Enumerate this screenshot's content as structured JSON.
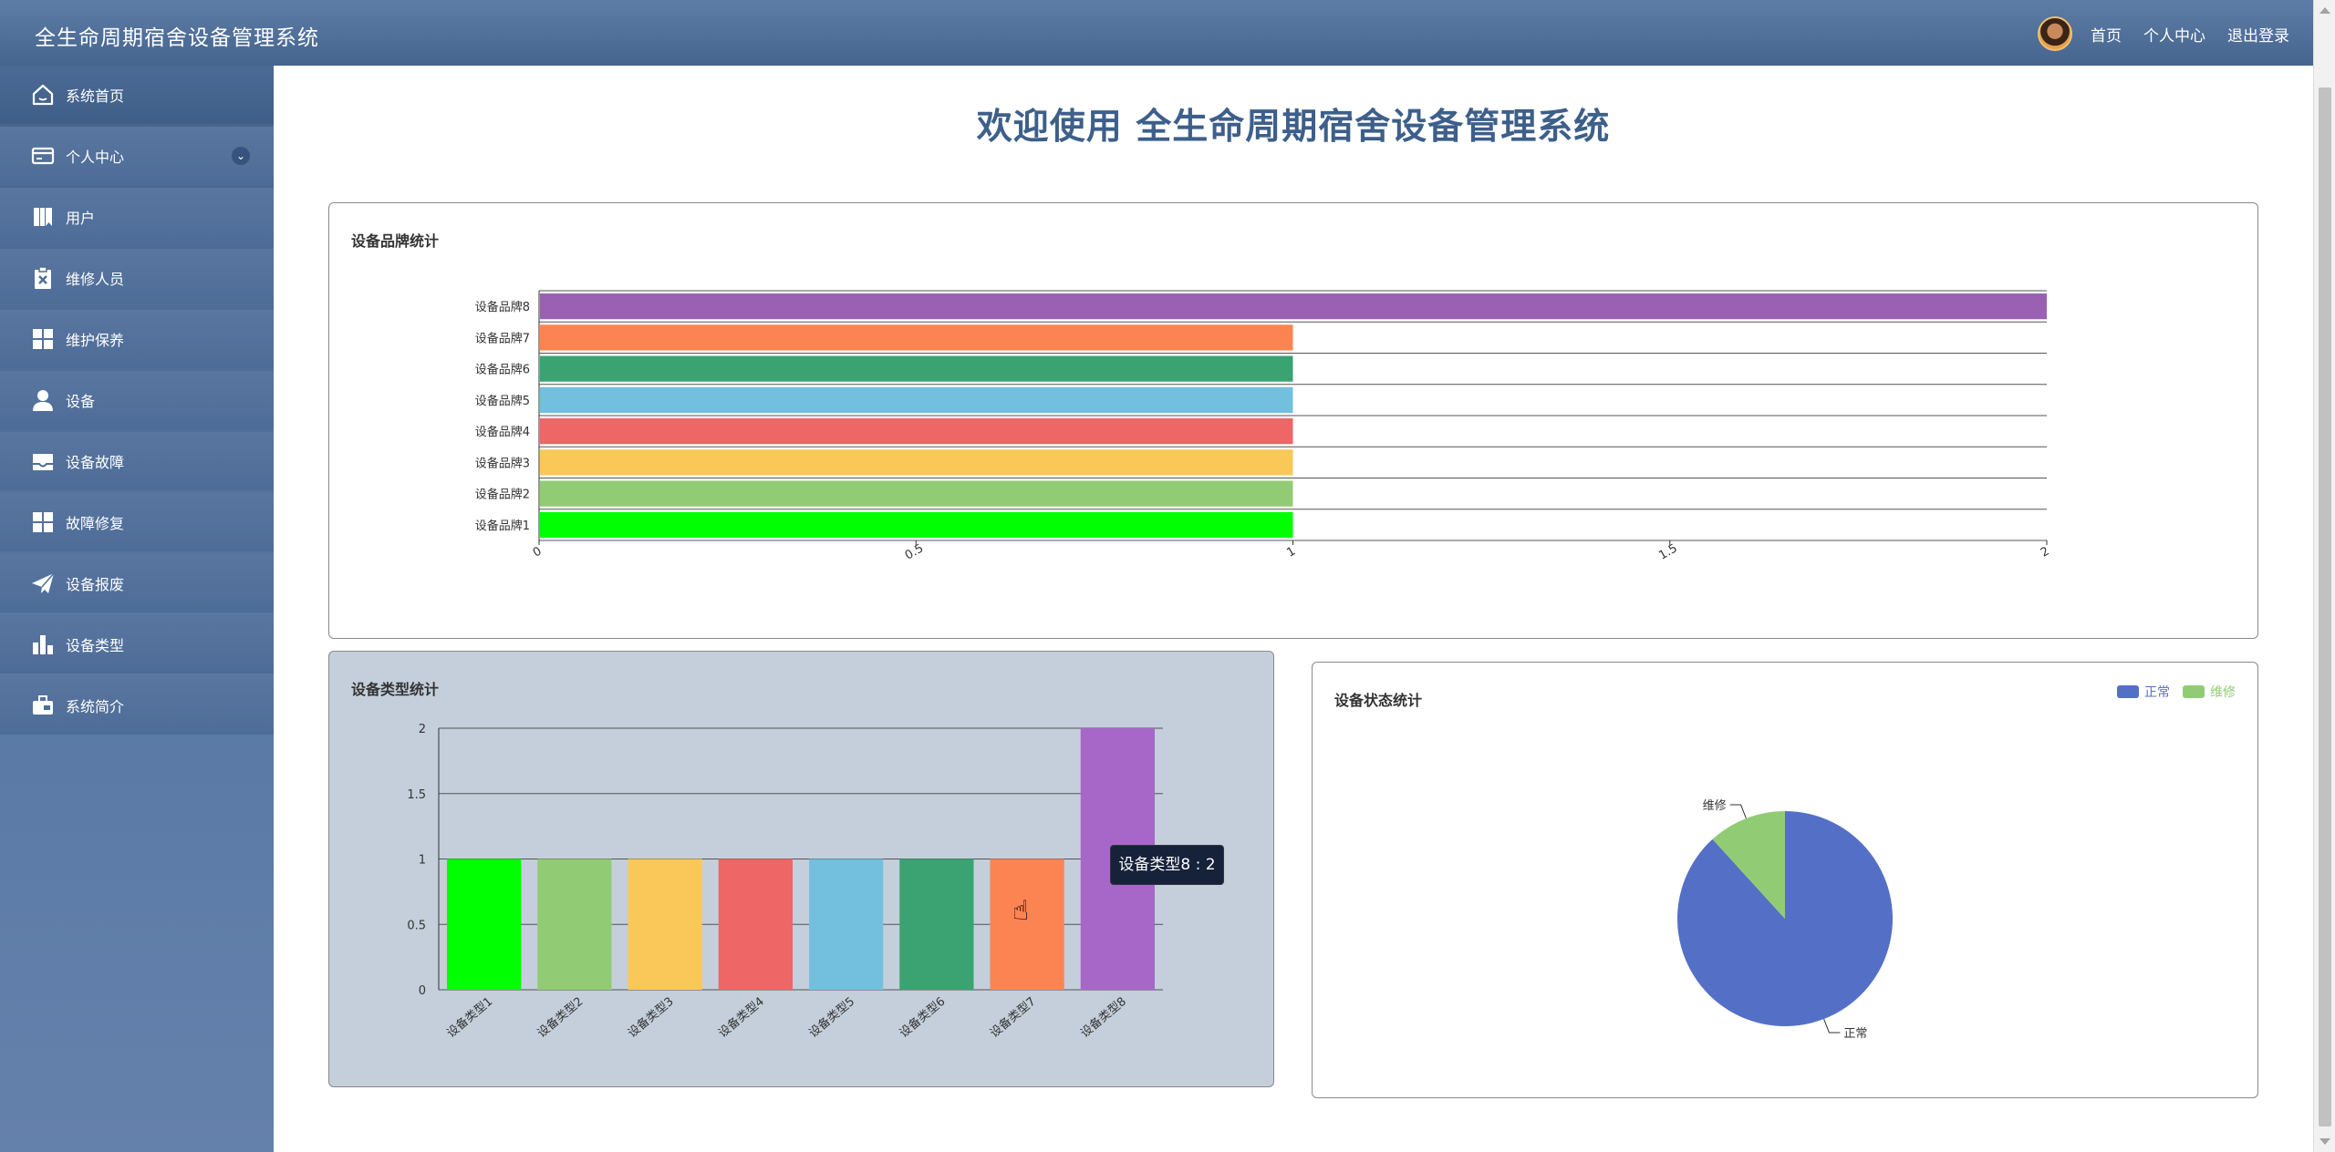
{
  "header": {
    "app_title": "全生命周期宿舍设备管理系统",
    "links": [
      "首页",
      "个人中心",
      "退出登录"
    ]
  },
  "sidebar": {
    "items": [
      {
        "label": "系统首页",
        "icon": "home-icon"
      },
      {
        "label": "个人中心",
        "icon": "card-icon"
      },
      {
        "label": "用户",
        "icon": "book-icon"
      },
      {
        "label": "维修人员",
        "icon": "clipboard-x-icon"
      },
      {
        "label": "维护保养",
        "icon": "grid-icon"
      },
      {
        "label": "设备",
        "icon": "user-icon"
      },
      {
        "label": "设备故障",
        "icon": "inbox-icon"
      },
      {
        "label": "故障修复",
        "icon": "grid-icon"
      },
      {
        "label": "设备报废",
        "icon": "paper-plane-icon"
      },
      {
        "label": "设备类型",
        "icon": "bar-chart-icon"
      },
      {
        "label": "系统简介",
        "icon": "briefcase-icon"
      }
    ]
  },
  "main": {
    "welcome": "欢迎使用 全生命周期宿舍设备管理系统"
  },
  "colors": {
    "palette": [
      "#00ff00",
      "#91cc75",
      "#fac858",
      "#ee6666",
      "#73c0de",
      "#3ba272",
      "#fc8452",
      "#9a60b4"
    ],
    "status": [
      "#5470c6",
      "#91cc75"
    ]
  },
  "chart_data": [
    {
      "type": "bar",
      "orientation": "horizontal",
      "title": "设备品牌统计",
      "categories": [
        "设备品牌1",
        "设备品牌2",
        "设备品牌3",
        "设备品牌4",
        "设备品牌5",
        "设备品牌6",
        "设备品牌7",
        "设备品牌8"
      ],
      "values": [
        1,
        1,
        1,
        1,
        1,
        1,
        1,
        2
      ],
      "xticks": [
        "0",
        "0.5",
        "1",
        "1.5",
        "2"
      ],
      "xlim": [
        0,
        2
      ],
      "grid": true
    },
    {
      "type": "bar",
      "title": "设备类型统计",
      "categories": [
        "设备类型1",
        "设备类型2",
        "设备类型3",
        "设备类型4",
        "设备类型5",
        "设备类型6",
        "设备类型7",
        "设备类型8"
      ],
      "values": [
        1,
        1,
        1,
        1,
        1,
        1,
        1,
        2
      ],
      "yticks": [
        "0",
        "0.5",
        "1",
        "1.5",
        "2"
      ],
      "ylim": [
        0,
        2
      ],
      "grid": true,
      "tooltip": "设备类型8 : 2"
    },
    {
      "type": "pie",
      "title": "设备状态统计",
      "labels": [
        "正常",
        "维修"
      ],
      "values": [
        15,
        2
      ],
      "legend": "top-right"
    }
  ]
}
